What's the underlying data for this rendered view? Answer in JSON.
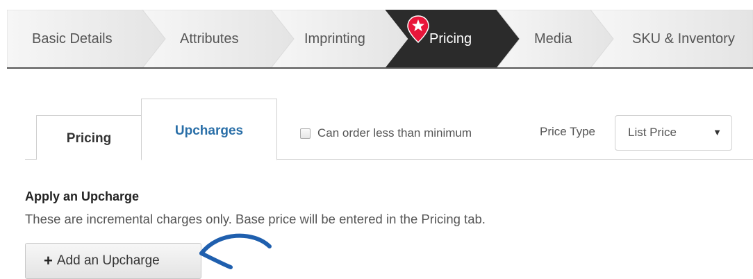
{
  "steps": [
    {
      "label": "Basic Details",
      "active": false
    },
    {
      "label": "Attributes",
      "active": false
    },
    {
      "label": "Imprinting",
      "active": false
    },
    {
      "label": "Pricing",
      "active": true
    },
    {
      "label": "Media",
      "active": false
    },
    {
      "label": "SKU & Inventory",
      "active": false
    }
  ],
  "tabs": [
    {
      "label": "Pricing",
      "active": false
    },
    {
      "label": "Upcharges",
      "active": true
    }
  ],
  "min_order": {
    "label": "Can order less than minimum",
    "checked": false
  },
  "price_type": {
    "label": "Price Type",
    "value": "List Price"
  },
  "upcharge": {
    "title": "Apply an Upcharge",
    "description": "These are incremental charges only. Base price will be entered in the Pricing tab.",
    "add_button": "Add an Upcharge"
  },
  "colors": {
    "active_step": "#2b2b2b",
    "active_tab_text": "#2a6fa8",
    "marker": "#e8163a",
    "annotation": "#1f5fae"
  },
  "icons": {
    "step_marker": "star-map-pin-icon",
    "select_arrow": "caret-down-icon",
    "add": "plus-icon",
    "annotation": "hand-drawn-arrow-icon"
  }
}
